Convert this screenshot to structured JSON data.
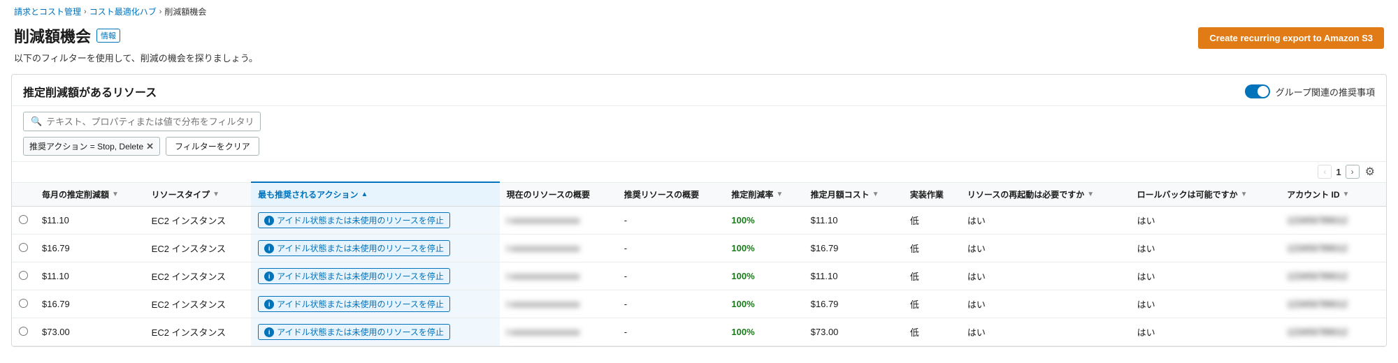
{
  "breadcrumb": {
    "items": [
      {
        "label": "請求とコスト管理",
        "href": "#"
      },
      {
        "label": "コスト最適化ハブ",
        "href": "#"
      },
      {
        "label": "削減額機会",
        "href": null
      }
    ],
    "separators": [
      "›",
      "›"
    ]
  },
  "page": {
    "title": "削減額機会",
    "info_badge": "情報",
    "subtitle": "以下のフィルターを使用して、削減の機会を探りましょう。"
  },
  "create_export_button": "Create recurring export to Amazon S3",
  "panel": {
    "title": "推定削減額があるリソース",
    "toggle_label": "グループ関連の推奨事項",
    "toggle_on": true,
    "search_placeholder": "テキスト、プロパティまたは値で分布をフィルタリング",
    "filter_chip_label": "推奨アクション = Stop, Delete",
    "clear_filter_label": "フィルターをクリア",
    "pagination": {
      "prev_disabled": true,
      "current": "1",
      "next_disabled": false
    }
  },
  "table": {
    "columns": [
      {
        "key": "radio",
        "label": ""
      },
      {
        "key": "monthly_savings",
        "label": "毎月の推定削減額",
        "sortable": true
      },
      {
        "key": "resource_type",
        "label": "リソースタイプ",
        "sortable": true
      },
      {
        "key": "recommended_action",
        "label": "最も推奨されるアクション",
        "sortable": true,
        "highlighted": true
      },
      {
        "key": "current_summary",
        "label": "現在のリソースの概要"
      },
      {
        "key": "recommended_summary",
        "label": "推奨リソースの概要"
      },
      {
        "key": "reduction_rate",
        "label": "推定削減率",
        "sortable": true
      },
      {
        "key": "monthly_cost",
        "label": "推定月額コスト",
        "sortable": true
      },
      {
        "key": "implementation",
        "label": "実装作業"
      },
      {
        "key": "restart_required",
        "label": "リソースの再起動は必要ですか",
        "sortable": true
      },
      {
        "key": "rollback_possible",
        "label": "ロールバックは可能ですか",
        "sortable": true
      },
      {
        "key": "account_id",
        "label": "アカウント ID",
        "sortable": true
      },
      {
        "key": "extra",
        "label": ""
      }
    ],
    "rows": [
      {
        "radio": false,
        "monthly_savings": "$11.10",
        "resource_type": "EC2 インスタンス",
        "recommended_action": "アイドル状態または未使用のリソースを停止",
        "current_summary": "i-",
        "current_blurred": true,
        "recommended_summary": "-",
        "reduction_rate": "100%",
        "monthly_cost": "$11.10",
        "implementation": "低",
        "restart_required": "はい",
        "rollback_possible": "はい",
        "account_id": "",
        "account_blurred": true,
        "extra": ""
      },
      {
        "radio": false,
        "monthly_savings": "$16.79",
        "resource_type": "EC2 インスタンス",
        "recommended_action": "アイドル状態または未使用のリソースを停止",
        "current_summary": "i-",
        "current_blurred": true,
        "recommended_summary": "-",
        "reduction_rate": "100%",
        "monthly_cost": "$16.79",
        "implementation": "低",
        "restart_required": "はい",
        "rollback_possible": "はい",
        "account_id": "",
        "account_blurred": true,
        "extra": ""
      },
      {
        "radio": false,
        "monthly_savings": "$11.10",
        "resource_type": "EC2 インスタンス",
        "recommended_action": "アイドル状態または未使用のリソースを停止",
        "current_summary": "i-",
        "current_blurred": true,
        "recommended_summary": "-",
        "reduction_rate": "100%",
        "monthly_cost": "$11.10",
        "implementation": "低",
        "restart_required": "はい",
        "rollback_possible": "はい",
        "account_id": "",
        "account_blurred": true,
        "extra": ""
      },
      {
        "radio": false,
        "monthly_savings": "$16.79",
        "resource_type": "EC2 インスタンス",
        "recommended_action": "アイドル状態または未使用のリソースを停止",
        "current_summary": "i-",
        "current_blurred": true,
        "recommended_summary": "-",
        "reduction_rate": "100%",
        "monthly_cost": "$16.79",
        "implementation": "低",
        "restart_required": "はい",
        "rollback_possible": "はい",
        "account_id": "",
        "account_blurred": true,
        "extra": ""
      },
      {
        "radio": false,
        "monthly_savings": "$73.00",
        "resource_type": "EC2 インスタンス",
        "recommended_action": "アイドル状態または未使用のリソースを停止",
        "current_summary": "i-",
        "current_blurred": true,
        "recommended_summary": "-",
        "reduction_rate": "100%",
        "monthly_cost": "$73.00",
        "implementation": "低",
        "restart_required": "はい",
        "rollback_possible": "はい",
        "account_id": "",
        "account_blurred": true,
        "extra": ""
      }
    ]
  }
}
